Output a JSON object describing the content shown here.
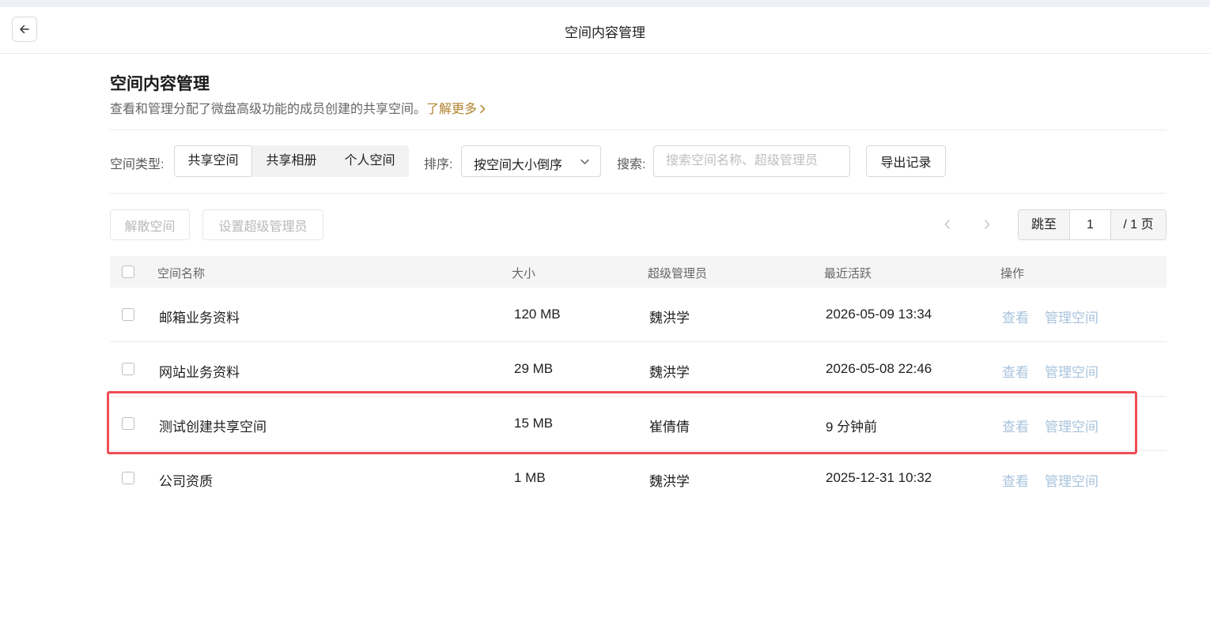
{
  "header": {
    "title": "空间内容管理",
    "back_icon": "arrow-left-icon"
  },
  "page": {
    "title": "空间内容管理",
    "description": "查看和管理分配了微盘高级功能的成员创建的共享空间。",
    "learn_more": "了解更多"
  },
  "filters": {
    "type_label": "空间类型:",
    "type_options": [
      "共享空间",
      "共享相册",
      "个人空间"
    ],
    "type_selected": "共享空间",
    "sort_label": "排序:",
    "sort_value": "按空间大小倒序",
    "search_label": "搜索:",
    "search_placeholder": "搜索空间名称、超级管理员",
    "export_label": "导出记录"
  },
  "actions": {
    "dissolve_label": "解散空间",
    "set_admin_label": "设置超级管理员"
  },
  "pagination": {
    "jump_label": "跳至",
    "current_page": "1",
    "total_label": "/ 1 页"
  },
  "table": {
    "columns": [
      "空间名称",
      "大小",
      "超级管理员",
      "最近活跃",
      "操作"
    ],
    "rows": [
      {
        "name": "邮箱业务资料",
        "size": "120 MB",
        "admin": "魏洪学",
        "active": "2026-05-09 13:34",
        "view": "查看",
        "manage": "管理空间"
      },
      {
        "name": "网站业务资料",
        "size": "29 MB",
        "admin": "魏洪学",
        "active": "2026-05-08 22:46",
        "view": "查看",
        "manage": "管理空间"
      },
      {
        "name": "测试创建共享空间",
        "size": "15 MB",
        "admin": "崔倩倩",
        "active": "9 分钟前",
        "view": "查看",
        "manage": "管理空间"
      },
      {
        "name": "公司资质",
        "size": "1 MB",
        "admin": "魏洪学",
        "active": "2025-12-31 10:32",
        "view": "查看",
        "manage": "管理空间"
      }
    ]
  },
  "colors": {
    "accent_link": "#b3822d",
    "operation_link": "#a8c3dd",
    "highlight": "#ef4d55"
  }
}
